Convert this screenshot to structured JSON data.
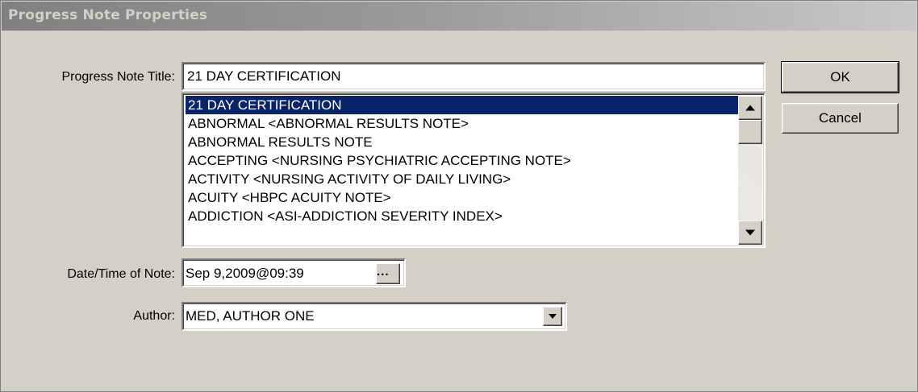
{
  "dialog": {
    "title": "Progress Note Properties"
  },
  "fields": {
    "title_label": "Progress Note Title:",
    "title_value": "21 DAY CERTIFICATION",
    "date_label": "Date/Time of Note:",
    "date_value": "Sep 9,2009@09:39",
    "date_picker_label": "...",
    "author_label": "Author:",
    "author_value": "MED, AUTHOR ONE"
  },
  "title_list": {
    "items": [
      "21 DAY CERTIFICATION",
      "ABNORMAL  <ABNORMAL RESULTS NOTE>",
      "ABNORMAL RESULTS NOTE",
      "ACCEPTING  <NURSING PSYCHIATRIC ACCEPTING NOTE>",
      "ACTIVITY  <NURSING ACTIVITY OF DAILY LIVING>",
      "ACUITY  <HBPC ACUITY NOTE>",
      "ADDICTION  <ASI-ADDICTION SEVERITY INDEX>"
    ],
    "selected_index": 0
  },
  "buttons": {
    "ok": "OK",
    "cancel": "Cancel"
  },
  "icons": {
    "scroll_up": "arrow-up-icon",
    "scroll_down": "arrow-down-icon",
    "dropdown": "chevron-down-icon"
  }
}
